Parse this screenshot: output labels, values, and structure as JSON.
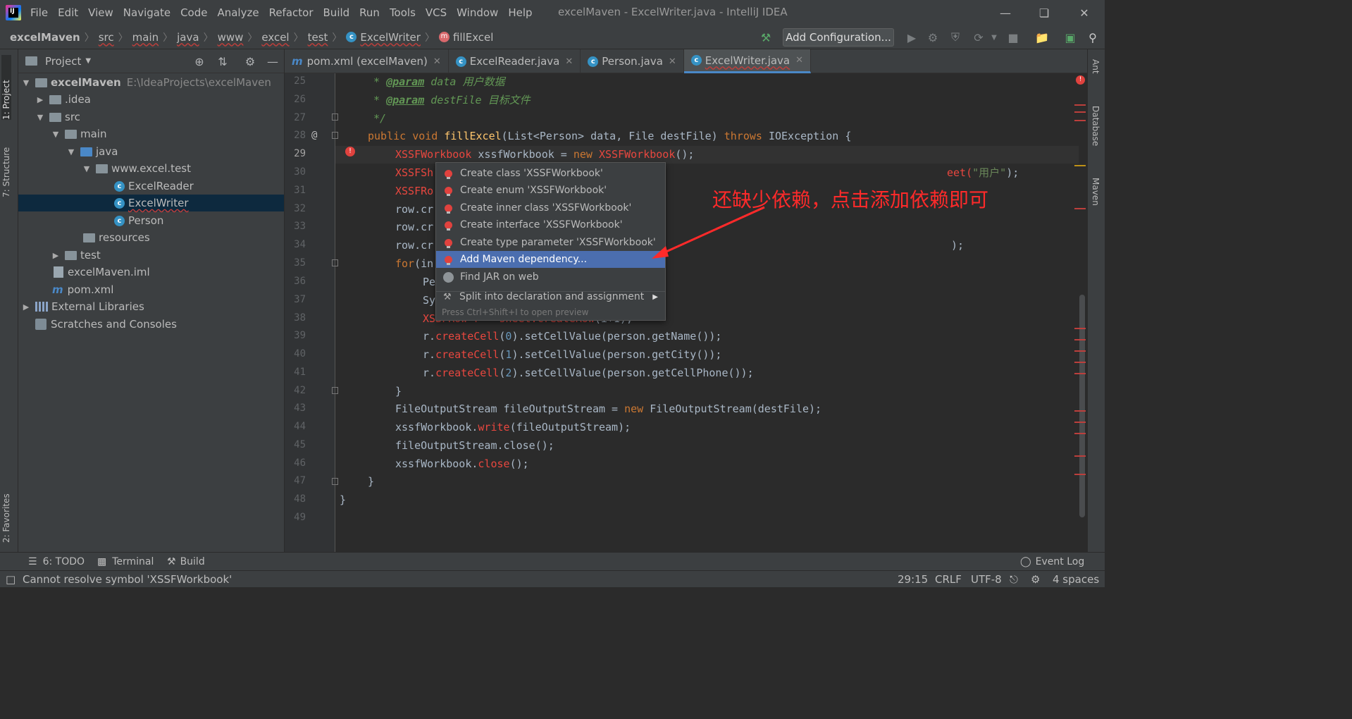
{
  "app": {
    "title": "excelMaven - ExcelWriter.java - IntelliJ IDEA",
    "logo_text": "IJ"
  },
  "menu": [
    "File",
    "Edit",
    "View",
    "Navigate",
    "Code",
    "Analyze",
    "Refactor",
    "Build",
    "Run",
    "Tools",
    "VCS",
    "Window",
    "Help"
  ],
  "breadcrumbs": [
    "excelMaven",
    "src",
    "main",
    "java",
    "www",
    "excel",
    "test",
    "ExcelWriter",
    "fillExcel"
  ],
  "toolbar": {
    "add_configuration": "Add Configuration..."
  },
  "left_strip": {
    "project_tab": "1: Project",
    "structure_tab": "7: Structure",
    "favorites_tab": "2: Favorites"
  },
  "right_strip": {
    "ant_tab": "Ant",
    "database_tab": "Database",
    "maven_tab": "Maven"
  },
  "project_panel": {
    "title": "Project",
    "tree": [
      {
        "label": "excelMaven",
        "path": "E:\\IdeaProjects\\excelMaven"
      },
      {
        "label": ".idea"
      },
      {
        "label": "src"
      },
      {
        "label": "main"
      },
      {
        "label": "java"
      },
      {
        "label": "www.excel.test"
      },
      {
        "label": "ExcelReader"
      },
      {
        "label": "ExcelWriter"
      },
      {
        "label": "Person"
      },
      {
        "label": "resources"
      },
      {
        "label": "test"
      },
      {
        "label": "excelMaven.iml"
      },
      {
        "label": "pom.xml"
      },
      {
        "label": "External Libraries"
      },
      {
        "label": "Scratches and Consoles"
      }
    ]
  },
  "tabs": [
    {
      "label": "pom.xml (excelMaven)"
    },
    {
      "label": "ExcelReader.java"
    },
    {
      "label": "Person.java"
    },
    {
      "label": "ExcelWriter.java"
    }
  ],
  "editor": {
    "line_numbers": [
      "25",
      "26",
      "27",
      "28",
      "29",
      "30",
      "31",
      "32",
      "33",
      "34",
      "35",
      "36",
      "37",
      "38",
      "39",
      "40",
      "41",
      "42",
      "43",
      "44",
      "45",
      "46",
      "47",
      "48",
      "49"
    ],
    "lines": {
      "l25_tag": "@param",
      "l25_name": " data ",
      "l25_desc": "用户数据",
      "l26_tag": "@param",
      "l26_name": " destFile ",
      "l26_desc": "目标文件",
      "l27": "*/",
      "l28_mod": "public void ",
      "l28_fn": "fillExcel",
      "l28_sig": "(List<Person> data, File destFile) ",
      "l28_throws": "throws ",
      "l28_exc": "IOException {",
      "l29_type": "XSSFWorkbook",
      "l29_var": " xssfWorkbook = ",
      "l29_new": "new ",
      "l29_ctor": "XSSFWorkbook",
      "l29_end": "();",
      "l30_a": "XSSFSh",
      "l30_b": "eet(",
      "l30_str": "\"用户\"",
      "l30_c": ");",
      "l31": "XSSFRo",
      "l32": "row.cr",
      "l33": "row.cr",
      "l34": "row.cr",
      "l34_end": ");",
      "l35_for": "for",
      "l35_rest": "(in",
      "l36": "Pe",
      "l37": "Sy",
      "l38_a": "XSSFRow r = sheet.",
      "l38_b": "createRow",
      "l38_c": "(i+1);",
      "l39_a": "r.",
      "l39_m": "createCell",
      "l39_b": "(",
      "l39_n": "0",
      "l39_c": ").setCellValue(person.getName());",
      "l40_a": "r.",
      "l40_m": "createCell",
      "l40_b": "(",
      "l40_n": "1",
      "l40_c": ").setCellValue(person.getCity());",
      "l41_a": "r.",
      "l41_m": "createCell",
      "l41_b": "(",
      "l41_n": "2",
      "l41_c": ").setCellValue(person.getCellPhone());",
      "l42": "}",
      "l43_a": "FileOutputStream fileOutputStream = ",
      "l43_new": "new ",
      "l43_b": "FileOutputStream(destFile);",
      "l44_a": "xssfWorkbook.",
      "l44_m": "write",
      "l44_b": "(fileOutputStream);",
      "l45": "fileOutputStream.close();",
      "l46_a": "xssfWorkbook.",
      "l46_m": "close",
      "l46_b": "();",
      "l47": "}",
      "l48": "}"
    }
  },
  "popup": {
    "items": [
      "Create class 'XSSFWorkbook'",
      "Create enum 'XSSFWorkbook'",
      "Create inner class 'XSSFWorkbook'",
      "Create interface 'XSSFWorkbook'",
      "Create type parameter 'XSSFWorkbook'",
      "Add Maven dependency...",
      "Find JAR on web",
      "Split into declaration and assignment"
    ],
    "hint": "Press Ctrl+Shift+I to open preview"
  },
  "annotation": "还缺少依赖，点击添加依赖即可",
  "bottom_tools": {
    "todo": "6: TODO",
    "terminal": "Terminal",
    "build": "Build",
    "event_log": "Event Log"
  },
  "status": {
    "message": "Cannot resolve symbol 'XSSFWorkbook'",
    "position": "29:15",
    "line_sep": "CRLF",
    "encoding": "UTF-8",
    "indent": "4 spaces"
  },
  "colors": {
    "error": "#e0423e",
    "selection": "#4b6eaf",
    "annotation": "#ff2a2a"
  }
}
